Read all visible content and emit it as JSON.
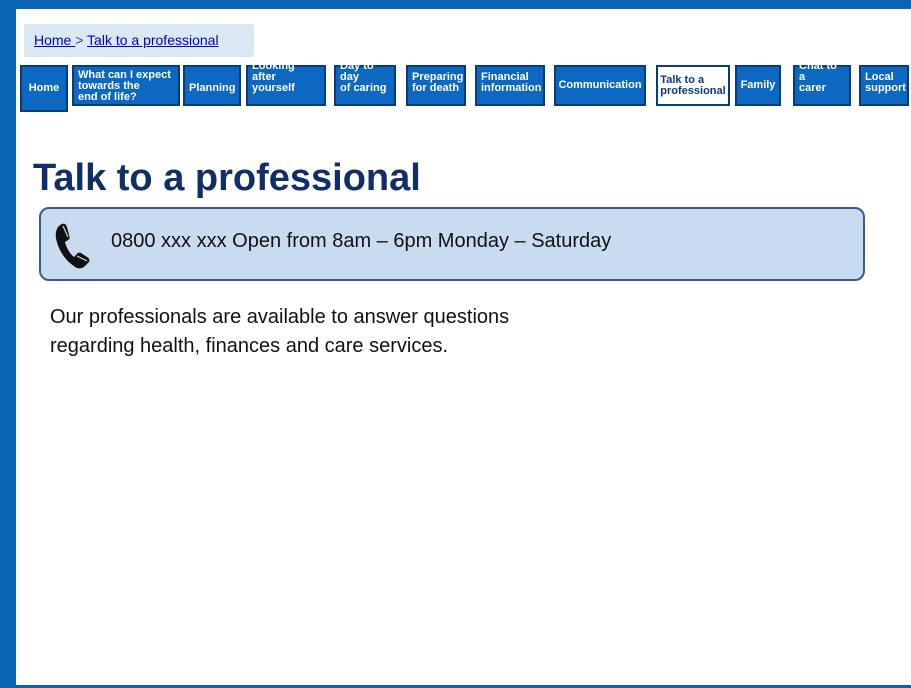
{
  "breadcrumb": {
    "home": "Home ",
    "separator": "> ",
    "current": "Talk to a professional"
  },
  "nav": [
    {
      "label": "Home"
    },
    {
      "label": "What can I expect\ntowards the\n end of life?"
    },
    {
      "label": "Planning"
    },
    {
      "label": "Looking after\nyourself"
    },
    {
      "label": "Day to day\nof caring"
    },
    {
      "label": "Preparing\nfor death"
    },
    {
      "label": "Financial\ninformation"
    },
    {
      "label": "Communication"
    },
    {
      "label": "Talk to a\nprofessional"
    },
    {
      "label": "Family"
    },
    {
      "label": "Chat to a\ncarer"
    },
    {
      "label": "Local\nsupport"
    }
  ],
  "active_tab": "Talk to a\nprofessional",
  "page_title": "Talk to a professional",
  "phone": {
    "icon": "phone-icon",
    "text": "0800 xxx xxx  Open from 8am – 6pm Monday – Saturday"
  },
  "body": [
    "Our professionals are available  to answer questions",
    "regarding health, finances and care services."
  ],
  "colors": {
    "frame": "#0a64b4",
    "tab": "#0c68c0",
    "title": "#0f2f66",
    "phone_box": "#c9dbef"
  }
}
